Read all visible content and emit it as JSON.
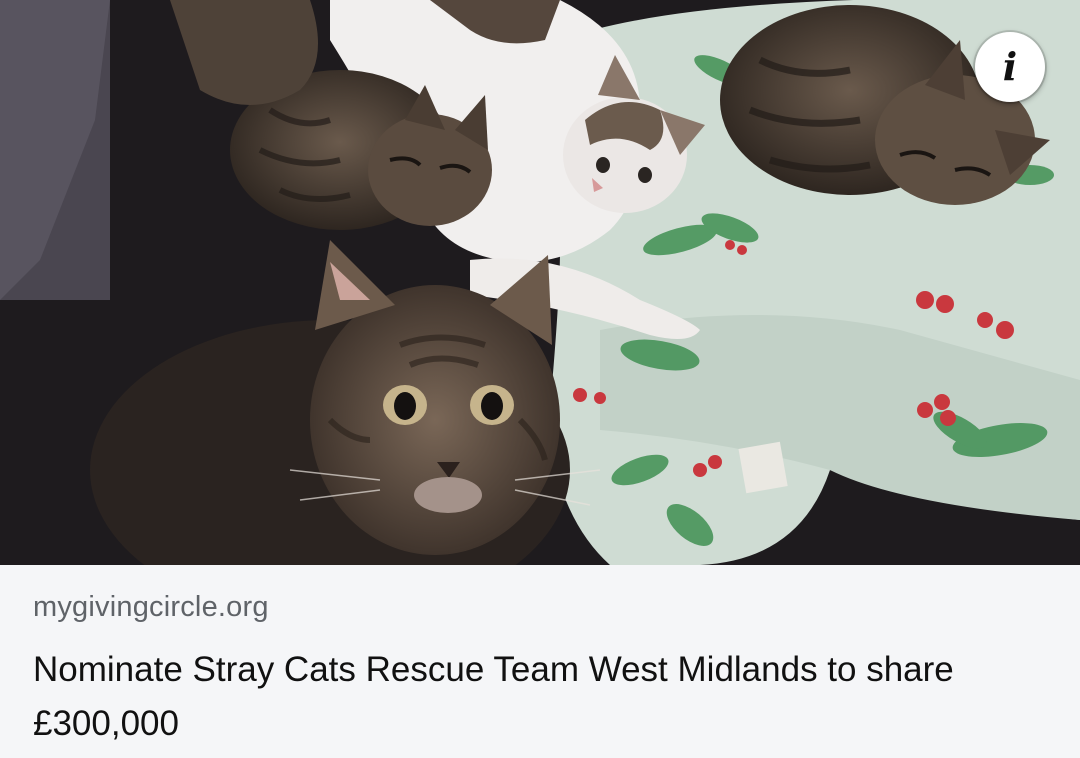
{
  "ad": {
    "image": {
      "icon": "photo-kittens",
      "description_icon": "cats-on-blanket-photo"
    },
    "info_button": {
      "glyph": "i",
      "icon": "info-icon"
    },
    "domain": "mygivingcircle.org",
    "headline": "Nominate Stray Cats Rescue Team West Midlands to share £300,000"
  },
  "colors": {
    "caption_background": "#f5f6f8",
    "domain_text": "#5f6368",
    "headline_text": "#111111"
  }
}
